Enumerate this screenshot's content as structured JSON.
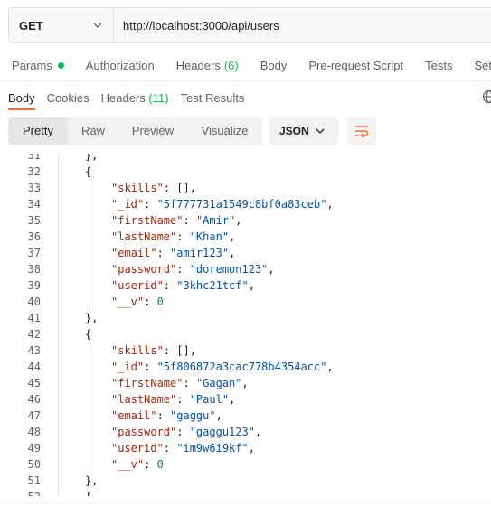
{
  "request": {
    "method": "GET",
    "url": "http://localhost:3000/api/users"
  },
  "request_tabs": [
    {
      "label": "Params",
      "indicator": true
    },
    {
      "label": "Authorization"
    },
    {
      "label": "Headers",
      "count": "(6)"
    },
    {
      "label": "Body"
    },
    {
      "label": "Pre-request Script"
    },
    {
      "label": "Tests"
    },
    {
      "label": "Set"
    }
  ],
  "response_tabs": [
    {
      "label": "Body",
      "active": true
    },
    {
      "label": "Cookies"
    },
    {
      "label": "Headers",
      "count": "(11)"
    },
    {
      "label": "Test Results"
    }
  ],
  "toolbar": {
    "views": [
      "Pretty",
      "Raw",
      "Preview",
      "Visualize"
    ],
    "selected_view": "Pretty",
    "format": "JSON",
    "wrap_icon": "wrap-lines-icon"
  },
  "code_lines": [
    {
      "n": "31",
      "t": "},",
      "indent": 0
    },
    {
      "n": "32",
      "t": "{",
      "indent": 0
    },
    {
      "n": "33",
      "k": "\"skills\"",
      "v": "[],",
      "vt": "plain",
      "indent": 1
    },
    {
      "n": "34",
      "k": "\"_id\"",
      "v": "\"5f777731a1549c8bf0a83ceb\"",
      "vt": "str",
      "c": ",",
      "indent": 1
    },
    {
      "n": "35",
      "k": "\"firstName\"",
      "v": "\"Amir\"",
      "vt": "str",
      "c": ",",
      "indent": 1
    },
    {
      "n": "36",
      "k": "\"lastName\"",
      "v": "\"Khan\"",
      "vt": "str",
      "c": ",",
      "indent": 1
    },
    {
      "n": "37",
      "k": "\"email\"",
      "v": "\"amir123\"",
      "vt": "str",
      "c": ",",
      "indent": 1
    },
    {
      "n": "38",
      "k": "\"password\"",
      "v": "\"doremon123\"",
      "vt": "str",
      "c": ",",
      "indent": 1
    },
    {
      "n": "39",
      "k": "\"userid\"",
      "v": "\"3khc21tcf\"",
      "vt": "str",
      "c": ",",
      "indent": 1
    },
    {
      "n": "40",
      "k": "\"__v\"",
      "v": "0",
      "vt": "num",
      "indent": 1
    },
    {
      "n": "41",
      "t": "},",
      "indent": 0
    },
    {
      "n": "42",
      "t": "{",
      "indent": 0
    },
    {
      "n": "43",
      "k": "\"skills\"",
      "v": "[],",
      "vt": "plain",
      "indent": 1
    },
    {
      "n": "44",
      "k": "\"_id\"",
      "v": "\"5f806872a3cac778b4354acc\"",
      "vt": "str",
      "c": ",",
      "indent": 1
    },
    {
      "n": "45",
      "k": "\"firstName\"",
      "v": "\"Gagan\"",
      "vt": "str",
      "c": ",",
      "indent": 1
    },
    {
      "n": "46",
      "k": "\"lastName\"",
      "v": "\"Paul\"",
      "vt": "str",
      "c": ",",
      "indent": 1
    },
    {
      "n": "47",
      "k": "\"email\"",
      "v": "\"gaggu\"",
      "vt": "str",
      "c": ",",
      "indent": 1
    },
    {
      "n": "48",
      "k": "\"password\"",
      "v": "\"gaggu123\"",
      "vt": "str",
      "c": ",",
      "indent": 1
    },
    {
      "n": "49",
      "k": "\"userid\"",
      "v": "\"im9w6i9kf\"",
      "vt": "str",
      "c": ",",
      "indent": 1
    },
    {
      "n": "50",
      "k": "\"__v\"",
      "v": "0",
      "vt": "num",
      "indent": 1
    },
    {
      "n": "51",
      "t": "},",
      "indent": 0
    },
    {
      "n": "52",
      "t": "{",
      "indent": 0
    }
  ],
  "colors": {
    "accent": "#ff6c37",
    "indicator": "#0cbb52",
    "key": "#a1260d",
    "string": "#0451a5",
    "number": "#098658"
  }
}
